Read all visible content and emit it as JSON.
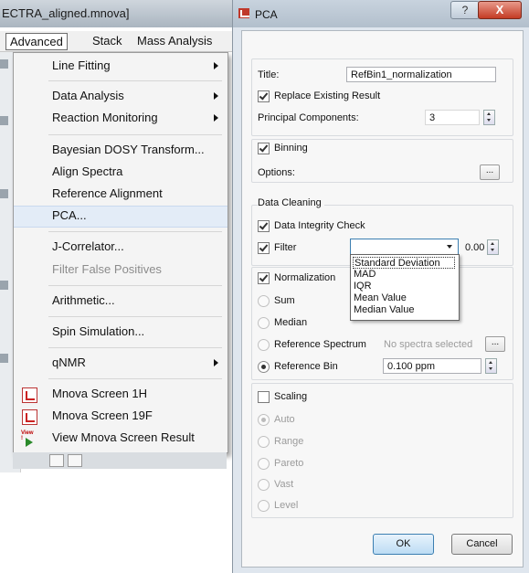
{
  "app": {
    "title": "ECTRA_aligned.mnova]",
    "menubar": [
      "Advanced",
      "Stack",
      "Mass Analysis"
    ]
  },
  "menu": {
    "items": [
      {
        "label": "Line Fitting",
        "submenu": true
      },
      {
        "label": "Data Analysis",
        "submenu": true
      },
      {
        "label": "Reaction Monitoring",
        "submenu": true
      },
      {
        "label": "Bayesian DOSY Transform..."
      },
      {
        "label": "Align Spectra"
      },
      {
        "label": "Reference Alignment"
      },
      {
        "label": "PCA...",
        "highlighted": true
      },
      {
        "label": "J-Correlator..."
      },
      {
        "label": "Filter False Positives",
        "disabled": true
      },
      {
        "label": "Arithmetic..."
      },
      {
        "label": "Spin Simulation..."
      },
      {
        "label": "qNMR",
        "submenu": true
      },
      {
        "label": "Mnova Screen 1H",
        "icon": "mnova-screen-icon"
      },
      {
        "label": "Mnova Screen 19F",
        "icon": "mnova-screen-icon"
      },
      {
        "label": "View Mnova Screen Result",
        "icon": "view-result-icon"
      }
    ],
    "view_icon_tag": "View !"
  },
  "dialog": {
    "title": "PCA",
    "help_label": "?",
    "close_label": "X",
    "title_label": "Title:",
    "title_value": "RefBin1_normalization",
    "replace_label": "Replace Existing Result",
    "replace_checked": true,
    "pc_label": "Principal Components:",
    "pc_value": "3",
    "binning_label": "Binning",
    "binning_checked": true,
    "options_label": "Options:",
    "ellipsis": "...",
    "cleaning_label": "Data Cleaning",
    "integrity_label": "Data Integrity Check",
    "filter_label": "Filter",
    "filter_value": "0.00",
    "filter_options": [
      "Standard Deviation",
      "MAD",
      "IQR",
      "Mean Value",
      "Median Value"
    ],
    "normalization_label": "Normalization",
    "norm_options": [
      "Sum",
      "Median",
      "Reference Spectrum",
      "Reference Bin"
    ],
    "norm_selected": "Reference Bin",
    "no_spectra": "No spectra selected",
    "ref_bin_value": "0.100 ppm",
    "scaling_label": "Scaling",
    "scaling_options": [
      "Auto",
      "Range",
      "Pareto",
      "Vast",
      "Level"
    ],
    "scaling_selected": "Auto",
    "ok_label": "OK",
    "cancel_label": "Cancel"
  }
}
